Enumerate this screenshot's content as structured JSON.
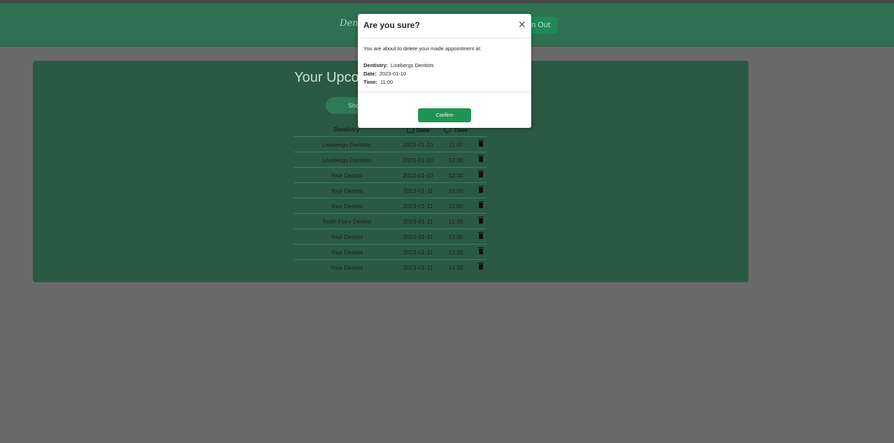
{
  "navbar": {
    "brand": "Dentis",
    "signout_label": "n Out"
  },
  "main": {
    "title": "Your Upco",
    "show_button": "Sho",
    "table": {
      "headers": [
        "Dentistry",
        "Date",
        "Time"
      ],
      "rows": [
        {
          "dentistry": "Lisebergs Dentists",
          "date": "2023-01-10",
          "time": "11:00"
        },
        {
          "dentistry": "Lisebergs Dentists",
          "date": "2023-01-10",
          "time": "12:30"
        },
        {
          "dentistry": "Your Dentist",
          "date": "2023-01-10",
          "time": "12:30"
        },
        {
          "dentistry": "Your Dentist",
          "date": "2023-01-11",
          "time": "10:00"
        },
        {
          "dentistry": "Your Dentist",
          "date": "2023-01-11",
          "time": "12:00"
        },
        {
          "dentistry": "Tooth Fairy Dentist",
          "date": "2023-01-11",
          "time": "12:30"
        },
        {
          "dentistry": "Your Dentist",
          "date": "2023-01-11",
          "time": "13:00"
        },
        {
          "dentistry": "Your Dentist",
          "date": "2023-01-11",
          "time": "13:30"
        },
        {
          "dentistry": "Your Dentist",
          "date": "2023-01-11",
          "time": "14:30"
        }
      ]
    }
  },
  "modal": {
    "title": "Are you sure?",
    "close_glyph": "✕",
    "message": "You are about to delete your made appointment at:",
    "dentistry_label": "Dentistry:",
    "dentistry_value": "Lisebergs Dentists",
    "date_label": "Date:",
    "date_value": "2023-01-10",
    "time_label": "Time:",
    "time_value": "11:00",
    "confirm_label": "Confirm"
  }
}
